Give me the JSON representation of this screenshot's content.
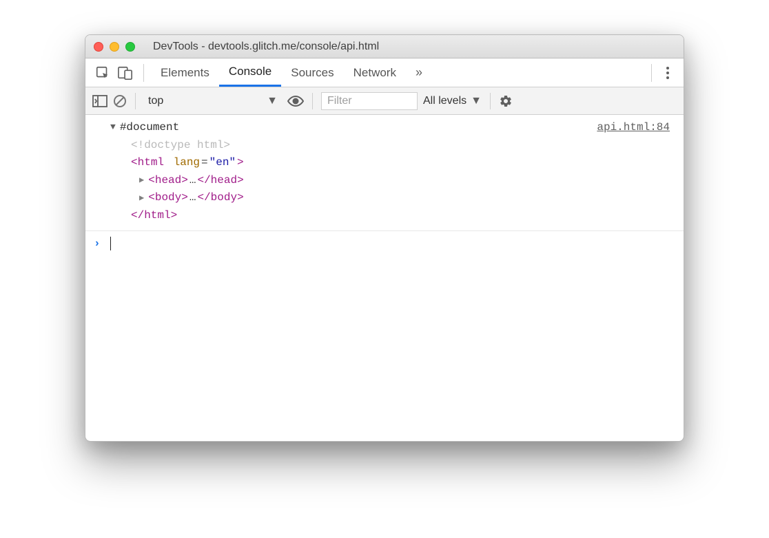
{
  "window": {
    "title": "DevTools - devtools.glitch.me/console/api.html"
  },
  "tabs": {
    "items": [
      {
        "label": "Elements"
      },
      {
        "label": "Console"
      },
      {
        "label": "Sources"
      },
      {
        "label": "Network"
      }
    ],
    "active_index": 1,
    "overflow_glyph": "»"
  },
  "console_toolbar": {
    "context": "top",
    "filter_placeholder": "Filter",
    "levels_label": "All levels"
  },
  "console": {
    "source_link": "api.html:84",
    "document_label": "#document",
    "doctype": "<!doctype html>",
    "html_open_tag": "html",
    "html_attr_name": "lang",
    "html_attr_value": "\"en\"",
    "head_tag": "head",
    "body_tag": "body",
    "ellipsis": "…",
    "html_close": "</html>"
  }
}
